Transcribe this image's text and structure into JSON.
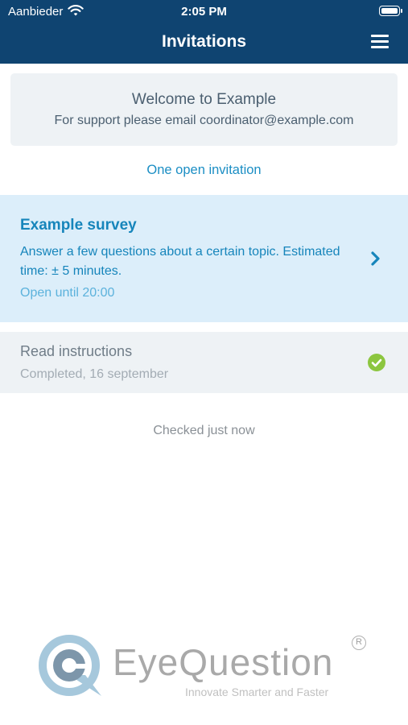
{
  "status_bar": {
    "carrier": "Aanbieder",
    "time": "2:05 PM"
  },
  "nav": {
    "title": "Invitations",
    "menu_icon": "hamburger-menu-icon"
  },
  "welcome": {
    "title": "Welcome to Example",
    "support": "For support please email coordinator@example.com"
  },
  "open_count": "One open invitation",
  "survey": {
    "title": "Example survey",
    "description": "Answer a few questions about a certain topic. Estimated time: ± 5 minutes.",
    "open_until": "Open until 20:00"
  },
  "instructions": {
    "title": "Read instructions",
    "status": "Completed, 16 september"
  },
  "checked_status": "Checked just now",
  "logo": {
    "brand": "EyeQuestion",
    "tagline": "Innovate Smarter and Faster",
    "registered": "R"
  },
  "colors": {
    "header": "#0f4471",
    "accent": "#1685bb",
    "survey_bg": "#dceefa",
    "success": "#8cc63f"
  }
}
